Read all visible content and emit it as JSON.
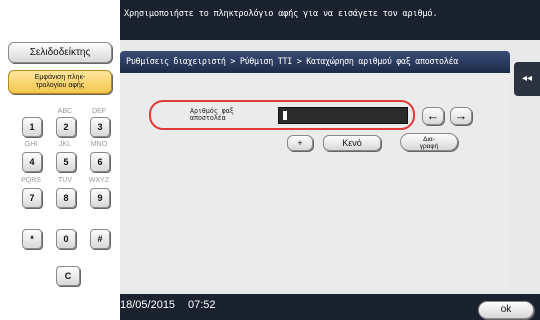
{
  "instruction": "Χρησιμοποιήστε το πληκτρολόγιο αφής για να εισάγετε τον αριθμό.",
  "breadcrumb": "Ρυθμίσεις διαχειριστή > Ρύθμιση TTI > Καταχώρηση αριθμού φαξ αποστολέα",
  "left": {
    "address_book_label": "Σελιδοδείκτης",
    "touch_keyboard_label_line1": "Εμφάνιση πληκ-",
    "touch_keyboard_label_line2": "τρολογίου αφής"
  },
  "keypad": {
    "letters": [
      "ABC",
      "DEF",
      "GHI",
      "JKL",
      "MNO",
      "PQRS",
      "TUV",
      "WXYZ"
    ],
    "keys": [
      "1",
      "2",
      "3",
      "4",
      "5",
      "6",
      "7",
      "8",
      "9",
      "*",
      "0",
      "#",
      "C"
    ]
  },
  "field": {
    "label_line1": "Αριθμός φαξ",
    "label_line2": "αποστολέα",
    "value": ""
  },
  "buttons": {
    "left_arrow": "←",
    "right_arrow": "→",
    "plus": "+",
    "space": "Κενό",
    "delete_line1": "Δια-",
    "delete_line2": "γραφή",
    "ok": "οk",
    "collapse": "◂◂"
  },
  "status": {
    "date": "18/05/2015",
    "time": "07:52"
  }
}
